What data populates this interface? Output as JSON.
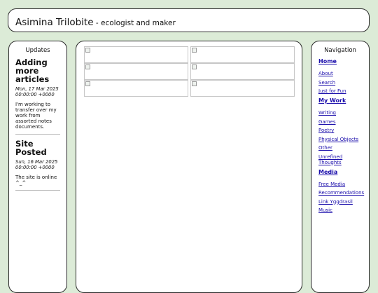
{
  "header": {
    "title": "Asimina Trilobite",
    "separator": " - ",
    "subtitle": "ecologist and maker"
  },
  "updates": {
    "title": "Updates",
    "posts": [
      {
        "title": "Adding more articles",
        "date": "Mon, 17 Mar 2025 00:00:00 +0000",
        "body": "I'm working to transfer over my work from assorted notes documents."
      },
      {
        "title": "Site Posted",
        "date": "Sun, 16 Mar 2025 00:00:00 +0000",
        "body": "The site is online ^_^"
      }
    ]
  },
  "navigation": {
    "title": "Navigation",
    "sections": [
      {
        "heading": "Home",
        "links": [
          "About",
          "Search",
          "Just for Fun"
        ]
      },
      {
        "heading": "My Work",
        "links": [
          "Writing",
          "Games",
          "Poetry",
          "Physical Objects",
          "Other",
          "Unrefined Thoughts"
        ]
      },
      {
        "heading": "Media",
        "links": [
          "Free Media",
          "Recommendations",
          "Link Yggdrasil",
          "Music"
        ]
      }
    ]
  },
  "gallery": {
    "image_count": 6,
    "columns": 2
  }
}
